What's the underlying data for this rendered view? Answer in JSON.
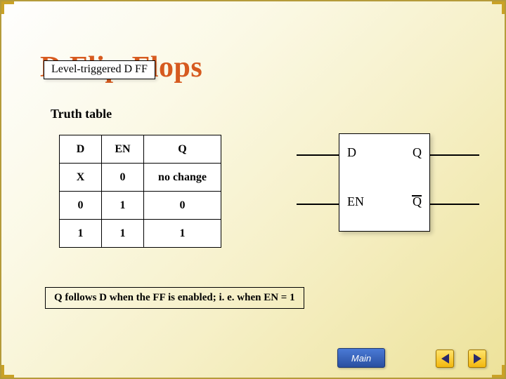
{
  "title": "D Flip-Flops",
  "subtitle": "Level-triggered D FF",
  "truth_label": "Truth table",
  "truth_table": {
    "headers": {
      "d": "D",
      "en": "EN",
      "q": "Q"
    },
    "rows": [
      {
        "d": "X",
        "en": "0",
        "q": "no change"
      },
      {
        "d": "0",
        "en": "1",
        "q": "0"
      },
      {
        "d": "1",
        "en": "1",
        "q": "1"
      }
    ]
  },
  "diagram": {
    "pins": {
      "d": "D",
      "en": "EN",
      "q": "Q",
      "qbar": "Q"
    }
  },
  "description": "Q follows D when the FF is enabled; i. e. when EN = 1",
  "nav": {
    "main_label": "Main",
    "prev_label": "Previous",
    "next_label": "Next"
  }
}
